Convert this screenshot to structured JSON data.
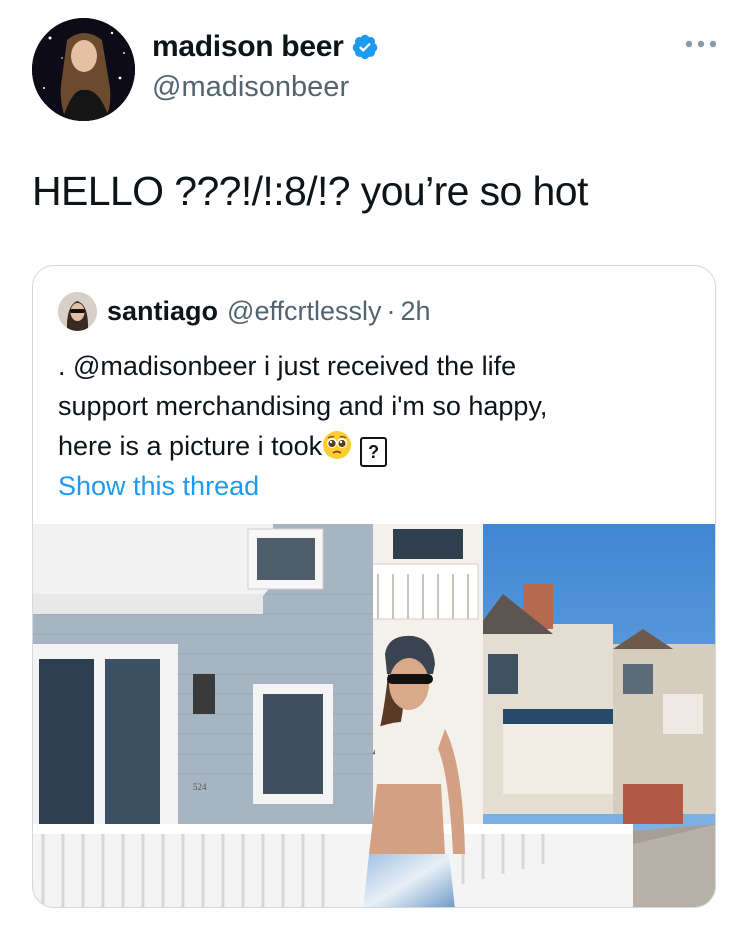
{
  "author": {
    "name": "madison beer",
    "handle": "@madisonbeer",
    "verified": true,
    "icons": [
      "avatar",
      "verified-badge-icon",
      "more-icon"
    ]
  },
  "tweet": {
    "text": "HELLO ???!/!:8/!? you’re so hot"
  },
  "quoted_tweet": {
    "name": "santiago",
    "handle": "@effcrtlessly",
    "separator": "·",
    "time": "2h",
    "text_line1": ". @madisonbeer i just received the life",
    "text_line2": "support merchandising and i'm so happy,",
    "text_line3": "here is a picture i took",
    "emoji": "pleading-face-icon",
    "unknown_glyph": "?",
    "show_thread": "Show this thread",
    "house_number": "524"
  },
  "colors": {
    "link": "#1d9bf0",
    "muted": "#536471",
    "border": "#cfd9de",
    "verified": "#1d9bf0"
  }
}
